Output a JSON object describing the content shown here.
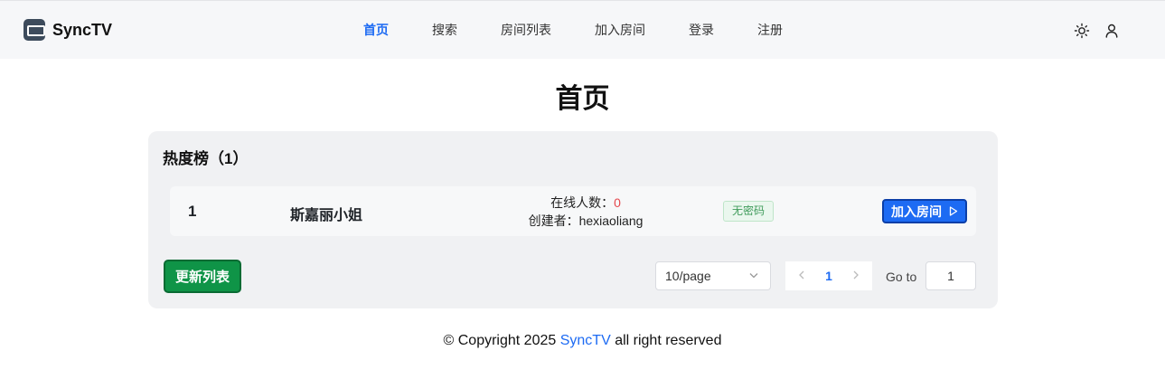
{
  "header": {
    "brand": "SyncTV",
    "nav": [
      {
        "label": "首页",
        "active": true
      },
      {
        "label": "搜索",
        "active": false
      },
      {
        "label": "房间列表",
        "active": false
      },
      {
        "label": "加入房间",
        "active": false
      },
      {
        "label": "登录",
        "active": false
      },
      {
        "label": "注册",
        "active": false
      }
    ],
    "icons": [
      "sun-icon",
      "user-icon"
    ]
  },
  "main": {
    "title": "首页",
    "card_title": "热度榜（1）",
    "rooms": [
      {
        "rank": "1",
        "name": "斯嘉丽小姐",
        "online_label": "在线人数：",
        "online_count": "0",
        "creator_label": "创建者：",
        "creator": "hexiaoliang",
        "badge": "无密码",
        "join_label": "加入房间",
        "join_icon": "play-icon"
      }
    ],
    "refresh_label": "更新列表",
    "pagination": {
      "page_size": "10/page",
      "current_page": "1",
      "goto_label": "Go to",
      "goto_value": "1"
    }
  },
  "footer": {
    "prefix": "© Copyright 2025",
    "brand": "SyncTV",
    "suffix": "all right reserved"
  },
  "colors": {
    "accent": "#1d6bf3",
    "success": "#0f9447",
    "danger": "#e5484d"
  }
}
